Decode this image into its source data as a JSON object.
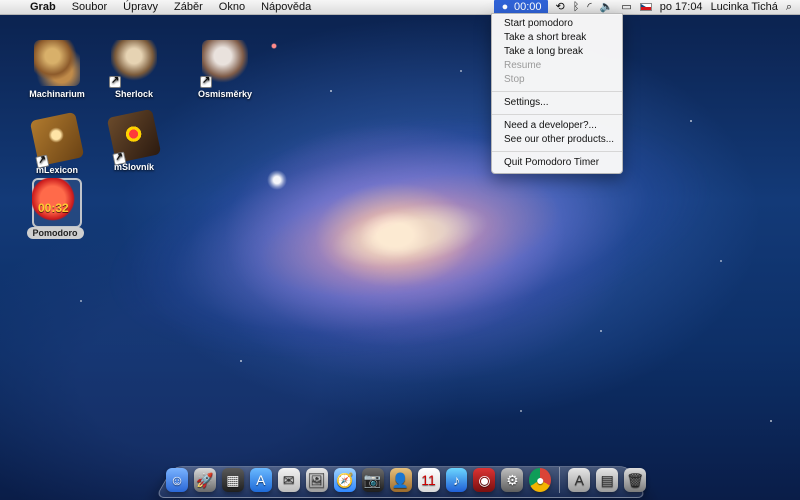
{
  "menubar": {
    "apple": "",
    "app_name": "Grab",
    "menus": [
      "Soubor",
      "Úpravy",
      "Záběr",
      "Okno",
      "Nápověda"
    ],
    "status": {
      "pomodoro_time": "00:00",
      "time": "po 17:04",
      "user": "Lucinka Tichá"
    }
  },
  "dropdown": {
    "items": [
      {
        "label": "Start pomodoro",
        "disabled": false
      },
      {
        "label": "Take a short break",
        "disabled": false
      },
      {
        "label": "Take a long break",
        "disabled": false
      },
      {
        "label": "Resume",
        "disabled": true
      },
      {
        "label": "Stop",
        "disabled": true
      },
      {
        "label": "Settings...",
        "disabled": false
      },
      {
        "label": "Need a developer?...",
        "disabled": false
      },
      {
        "label": "See our other products...",
        "disabled": false
      },
      {
        "label": "Quit Pomodoro Timer",
        "disabled": false
      }
    ]
  },
  "desktop": {
    "icons": [
      {
        "label": "Machinarium"
      },
      {
        "label": "Sherlock"
      },
      {
        "label": "Osmisměrky"
      },
      {
        "label": "mLexicon"
      },
      {
        "label": "mSlovník"
      }
    ],
    "pomodoro": {
      "label": "Pomodoro",
      "time": "00:32"
    }
  },
  "dock": {
    "items": [
      {
        "icon": "finder-icon"
      },
      {
        "icon": "launchpad-icon"
      },
      {
        "icon": "mission-control-icon"
      },
      {
        "icon": "app-store-icon"
      },
      {
        "icon": "mail-icon"
      },
      {
        "icon": "preview-icon"
      },
      {
        "icon": "safari-icon"
      },
      {
        "icon": "facetime-icon"
      },
      {
        "icon": "contacts-icon"
      },
      {
        "icon": "calendar-icon"
      },
      {
        "icon": "itunes-icon"
      },
      {
        "icon": "photo-booth-icon"
      },
      {
        "icon": "system-preferences-icon"
      },
      {
        "icon": "chrome-icon"
      },
      {
        "icon": "applications-folder-icon"
      },
      {
        "icon": "documents-folder-icon"
      },
      {
        "icon": "trash-icon"
      }
    ]
  }
}
